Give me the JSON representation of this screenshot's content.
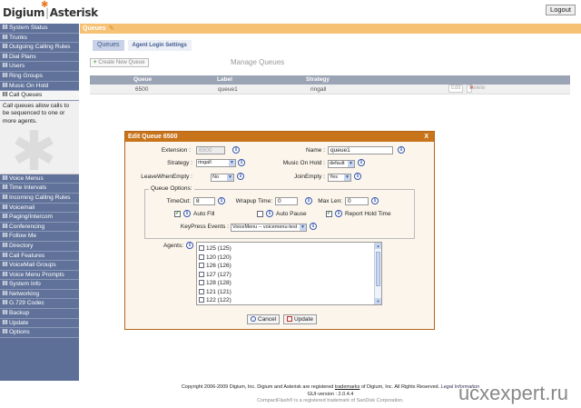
{
  "header": {
    "logo_brand": "Digium",
    "logo_separator": "|",
    "logo_product": "Asterisk",
    "logout_label": "Logout"
  },
  "sidebar": {
    "items_top": [
      "System Status",
      "Trunks",
      "Outgoing Calling Rules",
      "Dial Plans",
      "Users",
      "Ring Groups",
      "Music On Hold",
      "Call Queues"
    ],
    "active_description": "Call queues allow calls to be sequenced to one or more agents.",
    "items_bottom": [
      "Voice Menus",
      "Time Intervals",
      "Incoming Calling Rules",
      "Voicemail",
      "Paging/Intercom",
      "Conferencing",
      "Follow Me",
      "Directory",
      "Call Features",
      "VoiceMail Groups",
      "Voice Menu Prompts",
      "System Info",
      "Networking",
      "G.729 Codec",
      "Backup",
      "Update",
      "Options"
    ]
  },
  "main": {
    "title": "Queues",
    "tabs": [
      "Queues",
      "Agent Login Settings"
    ],
    "new_queue_label": "Create New Queue",
    "manage_title": "Manage Queues",
    "table": {
      "headers": [
        "Queue",
        "Label",
        "Strategy"
      ],
      "rows": [
        {
          "queue": "6500",
          "label": "queue1",
          "strategy": "ringall",
          "edit": "Edit",
          "delete": "Delete"
        }
      ]
    }
  },
  "dialog": {
    "title": "Edit Queue 6500",
    "close": "X",
    "extension_label": "Extension :",
    "extension_value": "6500",
    "name_label": "Name :",
    "name_value": "queue1",
    "strategy_label": "Strategy :",
    "strategy_value": "ringall",
    "moh_label": "Music On Hold :",
    "moh_value": "default",
    "lwe_label": "LeaveWhenEmpty :",
    "lwe_value": "No",
    "joinempty_label": "JoinEmpty :",
    "joinempty_value": "Yes",
    "options_legend": "Queue Options:",
    "timeout_label": "TimeOut:",
    "timeout_value": "8",
    "wrapup_label": "Wrapup Time:",
    "wrapup_value": "0",
    "maxlen_label": "Max Len:",
    "maxlen_value": "0",
    "autofill_label": "Auto Fill",
    "autofill_checked": true,
    "autopause_label": "Auto Pause",
    "autopause_checked": false,
    "reportholdtime_label": "Report Hold Time",
    "reportholdtime_checked": true,
    "keypress_label": "KeyPress Events :",
    "keypress_value": "VoiceMenu -- voicemenu-test",
    "agents_label": "Agents:",
    "agents": [
      "125 (125)",
      "120 (120)",
      "126 (126)",
      "127 (127)",
      "128 (128)",
      "121 (121)",
      "122 (122)"
    ],
    "cancel_label": "Cancel",
    "update_label": "Update"
  },
  "footer": {
    "copyright_prefix": "Copyright 2006-2009 Digium, Inc. Digium and Asterisk are registered",
    "trademarks_link": "trademarks",
    "copyright_suffix": "of Digium, Inc. All Rights Reserved.",
    "legal_link": "Legal Information",
    "version": "GUI-version : 2.0.4.4",
    "compactflash": "CompactFlash® is a registered trademark of SanDisk Corporation."
  },
  "watermark": "ucxexpert.ru",
  "colors": {
    "sidebar": "#5d6f97",
    "topbar": "#f6c173",
    "dialog_title": "#c7741b",
    "dialog_bg": "#fbf5ec"
  }
}
